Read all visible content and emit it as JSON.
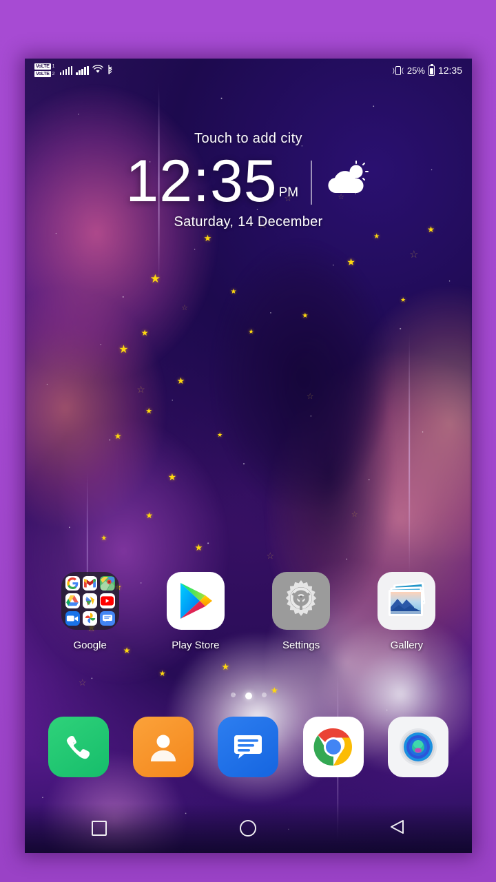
{
  "device": {
    "frame_color": "#a449d0",
    "screen_bg": "#2b1254"
  },
  "status_bar": {
    "volte_primary": "VoLTE",
    "volte_primary_sub": "1",
    "volte_secondary": "VoLTE",
    "volte_secondary_sub": "2",
    "signal_1_icon": "signal-bars-icon",
    "signal_2_icon": "signal-bars-icon",
    "wifi_icon": "wifi-icon",
    "bluetooth_icon": "bluetooth-icon",
    "vibrate_icon": "vibrate-icon",
    "battery_percent": "25%",
    "battery_icon": "battery-icon",
    "time": "12:35"
  },
  "clock_widget": {
    "city_prompt": "Touch to add city",
    "time": "12:35",
    "ampm": "PM",
    "date": "Saturday, 14 December",
    "weather_icon": "partly-cloudy-icon"
  },
  "apps": [
    {
      "label": "Google",
      "icon": "google-folder-icon",
      "type": "folder",
      "folder_apps": [
        "google-search-icon",
        "gmail-icon",
        "maps-icon",
        "drive-icon",
        "play-games-icon",
        "youtube-icon",
        "meet-icon",
        "photos-icon",
        "messages-icon"
      ]
    },
    {
      "label": "Play Store",
      "icon": "play-store-icon",
      "type": "app"
    },
    {
      "label": "Settings",
      "icon": "settings-gear-icon",
      "type": "app"
    },
    {
      "label": "Gallery",
      "icon": "gallery-icon",
      "type": "app"
    }
  ],
  "page_indicator": {
    "total": 3,
    "active": 2
  },
  "dock": [
    {
      "label": "Phone",
      "icon": "phone-icon",
      "color": "#1dbf6e"
    },
    {
      "label": "Contacts",
      "icon": "contacts-icon",
      "color": "#f4871c"
    },
    {
      "label": "Messages",
      "icon": "messages-icon",
      "color": "#1565e0"
    },
    {
      "label": "Chrome",
      "icon": "chrome-icon",
      "color": "#ffffff"
    },
    {
      "label": "Camera",
      "icon": "camera-icon",
      "color": "#f3f4f6"
    }
  ],
  "nav_bar": [
    {
      "name": "recents",
      "icon": "square-icon"
    },
    {
      "name": "home",
      "icon": "circle-icon"
    },
    {
      "name": "back",
      "icon": "triangle-left-icon"
    }
  ]
}
